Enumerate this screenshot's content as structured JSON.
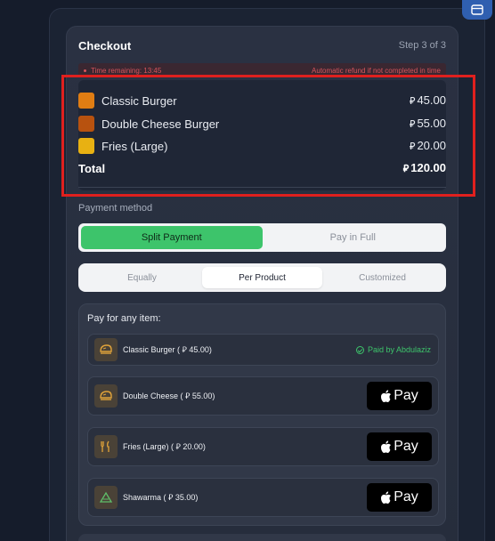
{
  "checkout": {
    "title": "Checkout",
    "step": "Step 3 of 3",
    "timer": "Time remaining: 13:45",
    "refund_note": "Automatic refund if not completed in time",
    "currency_symbol": "⃁",
    "items": [
      {
        "name": "Classic Burger",
        "price": "45.00",
        "color": "#e07d13"
      },
      {
        "name": "Double Cheese Burger",
        "price": "55.00",
        "color": "#b8520f"
      },
      {
        "name": "Fries (Large)",
        "price": "20.00",
        "color": "#e8b112"
      }
    ],
    "total_label": "Total",
    "total_value": "120.00"
  },
  "payment": {
    "label": "Payment method",
    "mode_options": [
      "Split Payment",
      "Pay in Full"
    ],
    "mode_selected": "Split Payment",
    "split_options": [
      "Equally",
      "Per Product",
      "Customized"
    ],
    "split_selected": "Per Product",
    "pay_title": "Pay for any item:",
    "apple_pay_label": "Pay",
    "items": [
      {
        "name": "Classic Burger ( ⃁ 45.00)",
        "icon": "burger-icon",
        "status": "Paid by Abdulaziz"
      },
      {
        "name": "Double Cheese ( ⃁ 55.00)",
        "icon": "burger-icon"
      },
      {
        "name": "Fries (Large) ( ⃁ 20.00)",
        "icon": "fries-icon"
      },
      {
        "name": "Shawarma ( ⃁ 35.00)",
        "icon": "shawarma-icon"
      }
    ]
  },
  "colors": {
    "accent_green": "#3dc46b",
    "alert_red": "#d8545b",
    "annotation_red": "#e0201e"
  }
}
